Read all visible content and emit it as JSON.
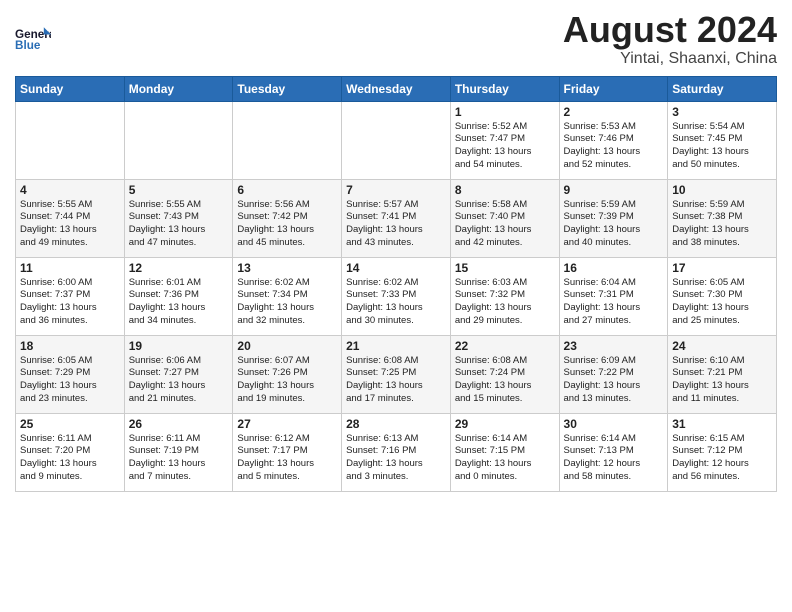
{
  "header": {
    "logo_general": "General",
    "logo_blue": "Blue",
    "month_year": "August 2024",
    "location": "Yintai, Shaanxi, China"
  },
  "days_of_week": [
    "Sunday",
    "Monday",
    "Tuesday",
    "Wednesday",
    "Thursday",
    "Friday",
    "Saturday"
  ],
  "weeks": [
    [
      {
        "day": "",
        "info": ""
      },
      {
        "day": "",
        "info": ""
      },
      {
        "day": "",
        "info": ""
      },
      {
        "day": "",
        "info": ""
      },
      {
        "day": "1",
        "info": "Sunrise: 5:52 AM\nSunset: 7:47 PM\nDaylight: 13 hours\nand 54 minutes."
      },
      {
        "day": "2",
        "info": "Sunrise: 5:53 AM\nSunset: 7:46 PM\nDaylight: 13 hours\nand 52 minutes."
      },
      {
        "day": "3",
        "info": "Sunrise: 5:54 AM\nSunset: 7:45 PM\nDaylight: 13 hours\nand 50 minutes."
      }
    ],
    [
      {
        "day": "4",
        "info": "Sunrise: 5:55 AM\nSunset: 7:44 PM\nDaylight: 13 hours\nand 49 minutes."
      },
      {
        "day": "5",
        "info": "Sunrise: 5:55 AM\nSunset: 7:43 PM\nDaylight: 13 hours\nand 47 minutes."
      },
      {
        "day": "6",
        "info": "Sunrise: 5:56 AM\nSunset: 7:42 PM\nDaylight: 13 hours\nand 45 minutes."
      },
      {
        "day": "7",
        "info": "Sunrise: 5:57 AM\nSunset: 7:41 PM\nDaylight: 13 hours\nand 43 minutes."
      },
      {
        "day": "8",
        "info": "Sunrise: 5:58 AM\nSunset: 7:40 PM\nDaylight: 13 hours\nand 42 minutes."
      },
      {
        "day": "9",
        "info": "Sunrise: 5:59 AM\nSunset: 7:39 PM\nDaylight: 13 hours\nand 40 minutes."
      },
      {
        "day": "10",
        "info": "Sunrise: 5:59 AM\nSunset: 7:38 PM\nDaylight: 13 hours\nand 38 minutes."
      }
    ],
    [
      {
        "day": "11",
        "info": "Sunrise: 6:00 AM\nSunset: 7:37 PM\nDaylight: 13 hours\nand 36 minutes."
      },
      {
        "day": "12",
        "info": "Sunrise: 6:01 AM\nSunset: 7:36 PM\nDaylight: 13 hours\nand 34 minutes."
      },
      {
        "day": "13",
        "info": "Sunrise: 6:02 AM\nSunset: 7:34 PM\nDaylight: 13 hours\nand 32 minutes."
      },
      {
        "day": "14",
        "info": "Sunrise: 6:02 AM\nSunset: 7:33 PM\nDaylight: 13 hours\nand 30 minutes."
      },
      {
        "day": "15",
        "info": "Sunrise: 6:03 AM\nSunset: 7:32 PM\nDaylight: 13 hours\nand 29 minutes."
      },
      {
        "day": "16",
        "info": "Sunrise: 6:04 AM\nSunset: 7:31 PM\nDaylight: 13 hours\nand 27 minutes."
      },
      {
        "day": "17",
        "info": "Sunrise: 6:05 AM\nSunset: 7:30 PM\nDaylight: 13 hours\nand 25 minutes."
      }
    ],
    [
      {
        "day": "18",
        "info": "Sunrise: 6:05 AM\nSunset: 7:29 PM\nDaylight: 13 hours\nand 23 minutes."
      },
      {
        "day": "19",
        "info": "Sunrise: 6:06 AM\nSunset: 7:27 PM\nDaylight: 13 hours\nand 21 minutes."
      },
      {
        "day": "20",
        "info": "Sunrise: 6:07 AM\nSunset: 7:26 PM\nDaylight: 13 hours\nand 19 minutes."
      },
      {
        "day": "21",
        "info": "Sunrise: 6:08 AM\nSunset: 7:25 PM\nDaylight: 13 hours\nand 17 minutes."
      },
      {
        "day": "22",
        "info": "Sunrise: 6:08 AM\nSunset: 7:24 PM\nDaylight: 13 hours\nand 15 minutes."
      },
      {
        "day": "23",
        "info": "Sunrise: 6:09 AM\nSunset: 7:22 PM\nDaylight: 13 hours\nand 13 minutes."
      },
      {
        "day": "24",
        "info": "Sunrise: 6:10 AM\nSunset: 7:21 PM\nDaylight: 13 hours\nand 11 minutes."
      }
    ],
    [
      {
        "day": "25",
        "info": "Sunrise: 6:11 AM\nSunset: 7:20 PM\nDaylight: 13 hours\nand 9 minutes."
      },
      {
        "day": "26",
        "info": "Sunrise: 6:11 AM\nSunset: 7:19 PM\nDaylight: 13 hours\nand 7 minutes."
      },
      {
        "day": "27",
        "info": "Sunrise: 6:12 AM\nSunset: 7:17 PM\nDaylight: 13 hours\nand 5 minutes."
      },
      {
        "day": "28",
        "info": "Sunrise: 6:13 AM\nSunset: 7:16 PM\nDaylight: 13 hours\nand 3 minutes."
      },
      {
        "day": "29",
        "info": "Sunrise: 6:14 AM\nSunset: 7:15 PM\nDaylight: 13 hours\nand 0 minutes."
      },
      {
        "day": "30",
        "info": "Sunrise: 6:14 AM\nSunset: 7:13 PM\nDaylight: 12 hours\nand 58 minutes."
      },
      {
        "day": "31",
        "info": "Sunrise: 6:15 AM\nSunset: 7:12 PM\nDaylight: 12 hours\nand 56 minutes."
      }
    ]
  ]
}
